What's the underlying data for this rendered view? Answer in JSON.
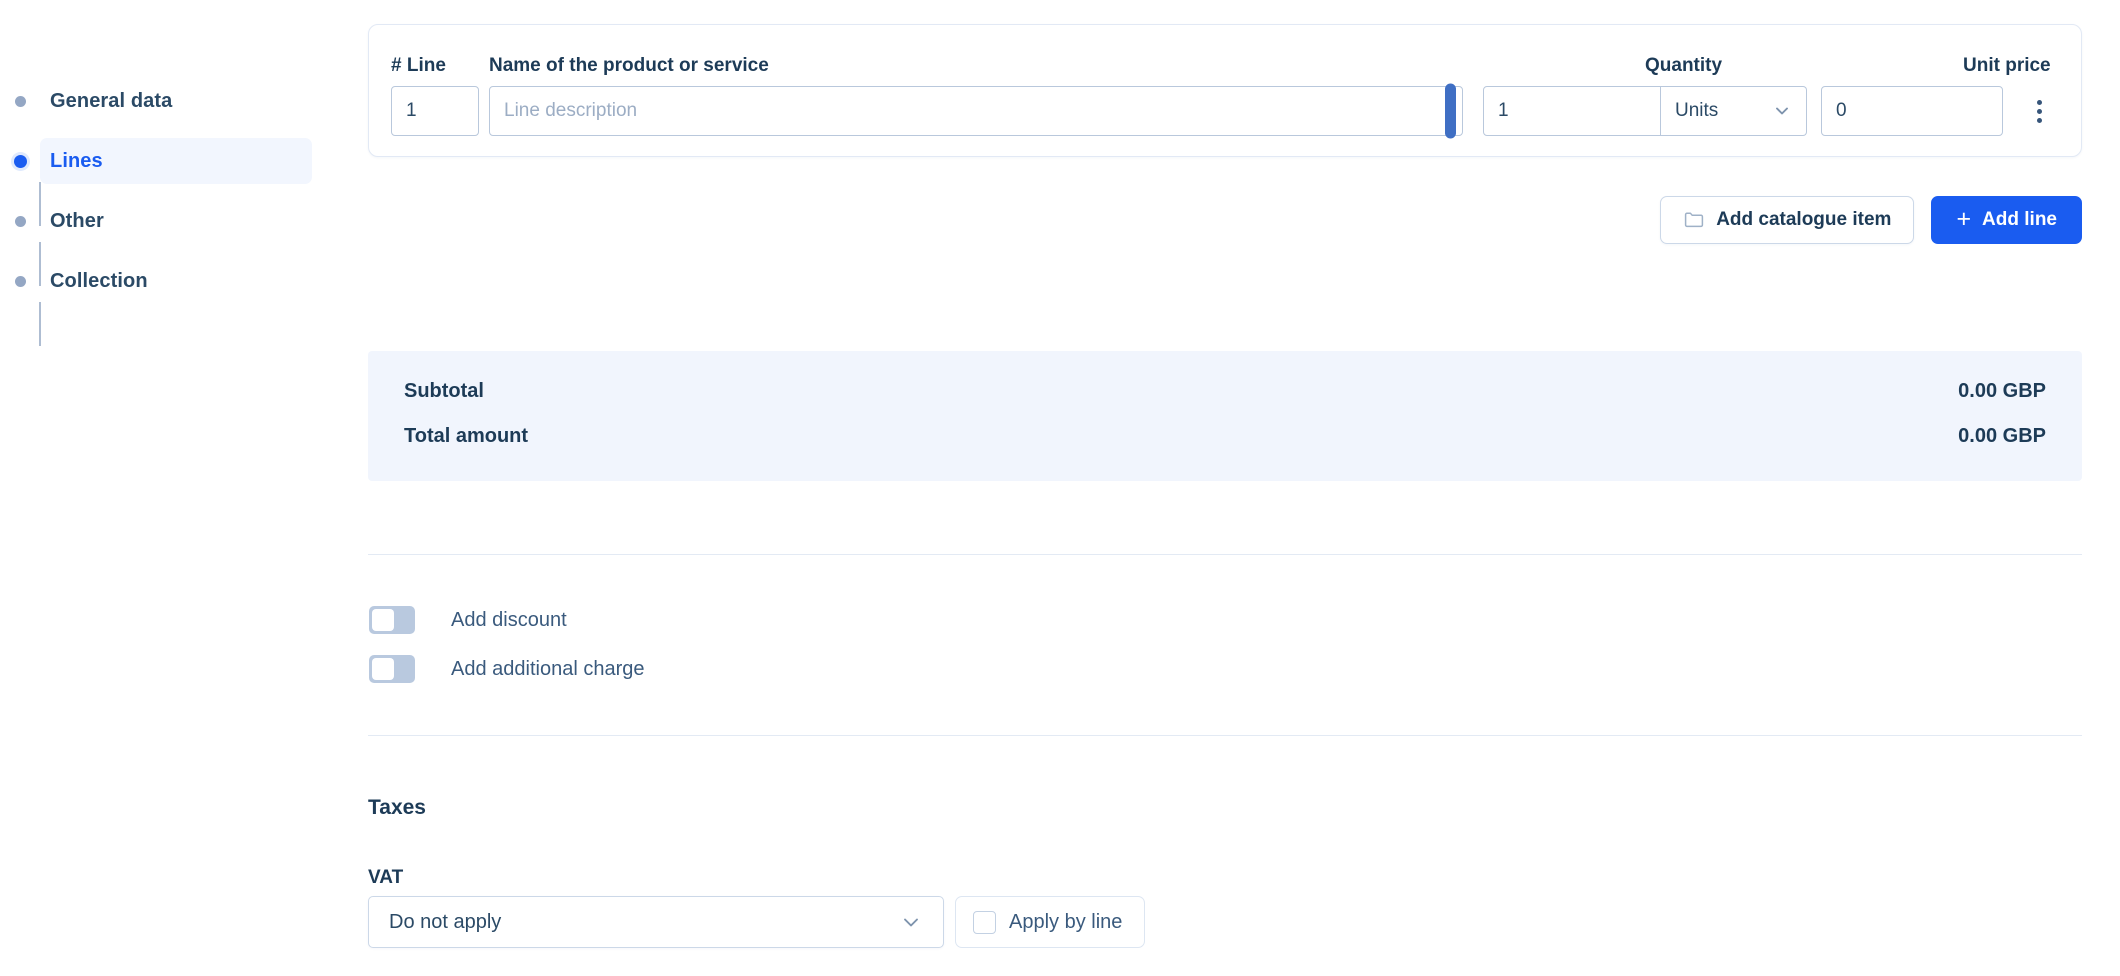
{
  "stepper": {
    "items": [
      {
        "label": "General data",
        "active": false
      },
      {
        "label": "Lines",
        "active": true
      },
      {
        "label": "Other",
        "active": false
      },
      {
        "label": "Collection",
        "active": false
      }
    ]
  },
  "lines_table": {
    "headers": {
      "line": "# Line",
      "name": "Name of the product or service",
      "quantity": "Quantity",
      "unit_price": "Unit price"
    },
    "rows": [
      {
        "line_number": "1",
        "description_value": "",
        "description_placeholder": "Line description",
        "quantity": "1",
        "unit": "Units",
        "unit_price": "0"
      }
    ],
    "row_menu_icon": "kebab-menu-icon",
    "resize_handle_icon": "drag-handle-icon"
  },
  "actions": {
    "add_catalogue_item": "Add catalogue item",
    "add_catalogue_icon": "folder-icon",
    "add_line": "Add line",
    "add_line_icon": "plus-icon"
  },
  "totals": {
    "rows": [
      {
        "label": "Subtotal",
        "value": "0.00 GBP"
      },
      {
        "label": "Total amount",
        "value": "0.00 GBP"
      }
    ]
  },
  "toggles": [
    {
      "label": "Add discount",
      "checked": false
    },
    {
      "label": "Add additional charge",
      "checked": false
    }
  ],
  "taxes": {
    "title": "Taxes",
    "vat_label": "VAT",
    "vat_value": "Do not apply",
    "apply_by_line_label": "Apply by line",
    "apply_by_line_checked": false,
    "chevron_icon": "chevron-down-icon"
  },
  "colors": {
    "accent": "#1a5cf0",
    "text_dark": "#1d3b57",
    "text_muted": "#3a5a7d",
    "panel_bg": "#f1f5fd",
    "border": "#ccd8e8",
    "handle": "#3f6fc4"
  }
}
